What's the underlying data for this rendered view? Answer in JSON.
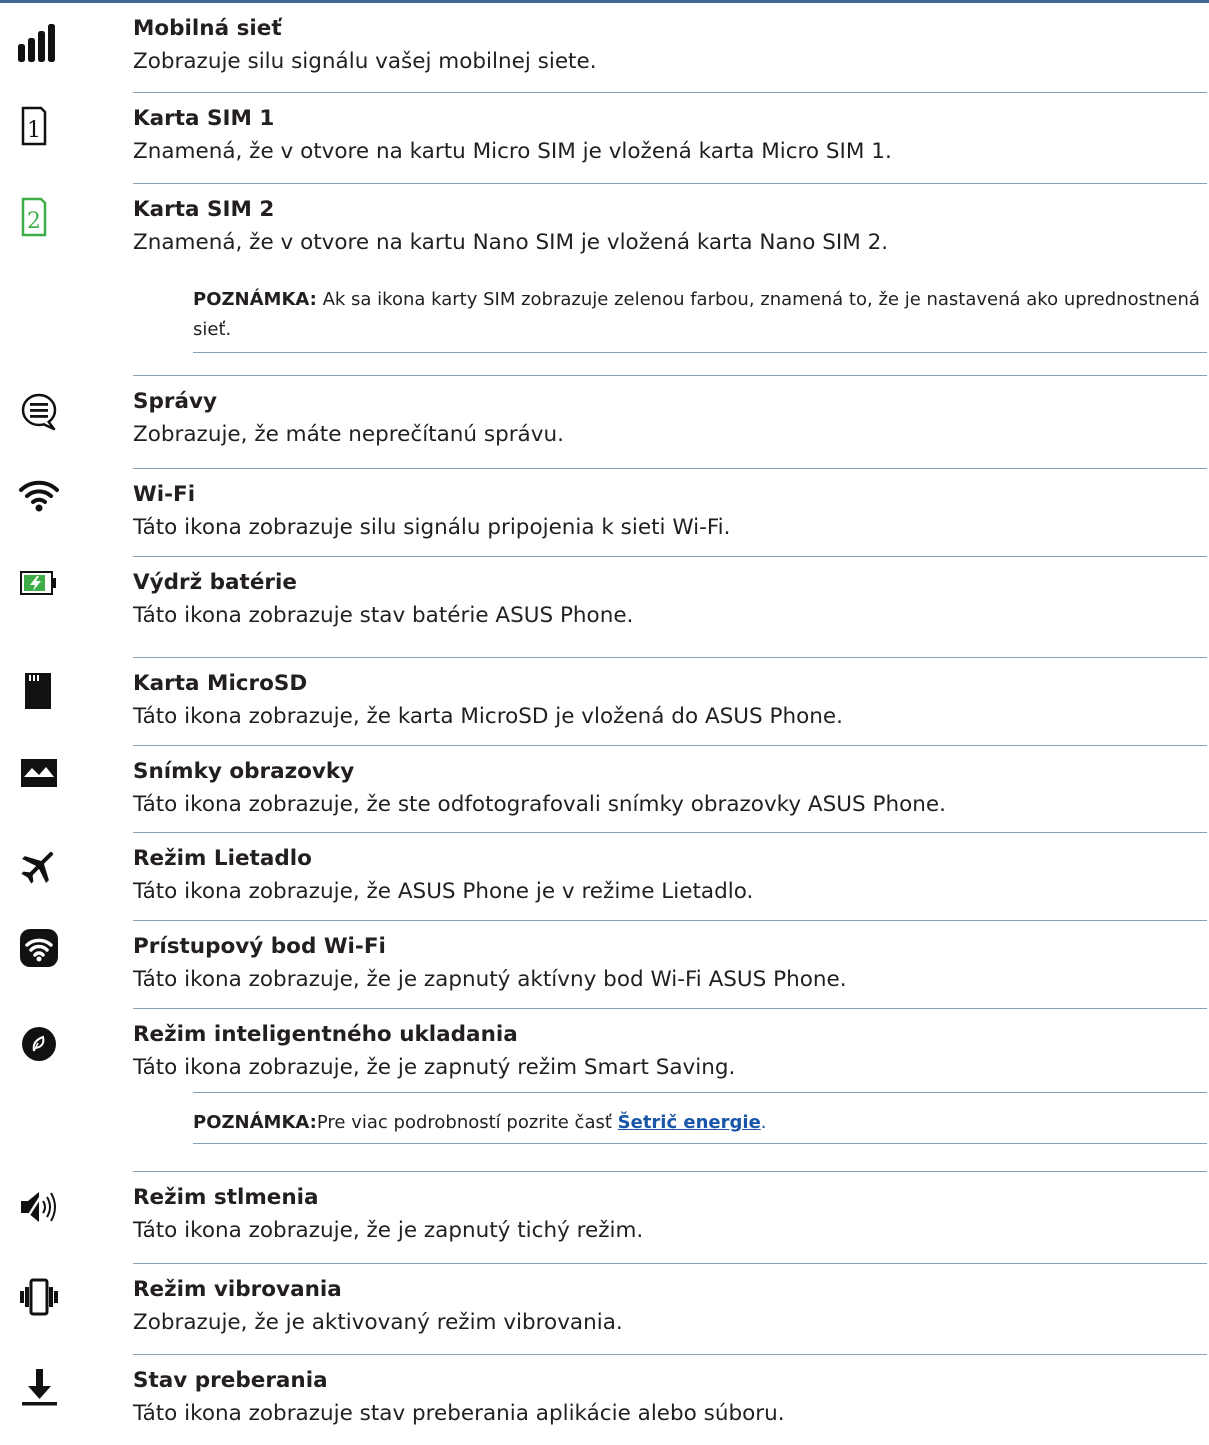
{
  "items": [
    {
      "icon": "signal-bars-icon",
      "title": "Mobilná sieť",
      "desc": "Zobrazuje silu signálu vašej mobilnej siete."
    },
    {
      "icon": "sim1-icon",
      "title": "Karta SIM 1",
      "desc": "Znamená, že v otvore na kartu Micro SIM je vložená karta Micro SIM 1."
    },
    {
      "icon": "sim2-icon",
      "title": "Karta SIM 2",
      "desc": "Znamená, že v otvore na kartu Nano SIM je vložená karta Nano SIM 2."
    },
    {
      "icon": "message-icon",
      "title": "Správy",
      "desc": "Zobrazuje, že máte neprečítanú správu."
    },
    {
      "icon": "wifi-icon",
      "title": "Wi-Fi",
      "desc": "Táto ikona zobrazuje silu signálu pripojenia k sieti Wi-Fi."
    },
    {
      "icon": "battery-icon",
      "title": "Výdrž batérie",
      "desc": "Táto ikona zobrazuje stav batérie ASUS Phone."
    },
    {
      "icon": "microsd-icon",
      "title": "Karta MicroSD",
      "desc": "Táto ikona zobrazuje, že karta MicroSD je vložená do ASUS Phone."
    },
    {
      "icon": "screenshot-icon",
      "title": "Snímky obrazovky",
      "desc": "Táto ikona zobrazuje, že ste odfotografovali snímky obrazovky ASUS Phone."
    },
    {
      "icon": "airplane-icon",
      "title": "Režim Lietadlo",
      "desc": "Táto ikona zobrazuje, že ASUS Phone je v režime Lietadlo."
    },
    {
      "icon": "hotspot-icon",
      "title": "Prístupový bod Wi-Fi",
      "desc": "Táto ikona zobrazuje, že je zapnutý aktívny bod Wi-Fi ASUS Phone."
    },
    {
      "icon": "smart-saving-icon",
      "title": "Režim inteligentného ukladania",
      "desc": "Táto ikona zobrazuje, že je zapnutý režim Smart Saving."
    },
    {
      "icon": "mute-icon",
      "title": "Režim stlmenia",
      "desc": "Táto ikona zobrazuje, že je zapnutý tichý režim."
    },
    {
      "icon": "vibrate-icon",
      "title": "Režim vibrovania",
      "desc": "Zobrazuje, že je aktivovaný režim vibrovania."
    },
    {
      "icon": "download-icon",
      "title": "Stav preberania",
      "desc": "Táto ikona zobrazuje stav preberania aplikácie alebo súboru."
    }
  ],
  "notes": {
    "sim": {
      "label": "POZNÁMKA:",
      "text": " Ak sa ikona karty SIM zobrazuje zelenou farbou, znamená to, že je nastavená ako uprednostnená sieť."
    },
    "saving": {
      "label": "POZNÁMKA:",
      "text": "Pre viac podrobností pozrite časť ",
      "link": "Šetrič energie",
      "after": "."
    }
  },
  "colors": {
    "accent": "#3b6791",
    "rule": "#8aa0b8",
    "sim_green": "#3fae49",
    "link": "#1a56a8"
  }
}
